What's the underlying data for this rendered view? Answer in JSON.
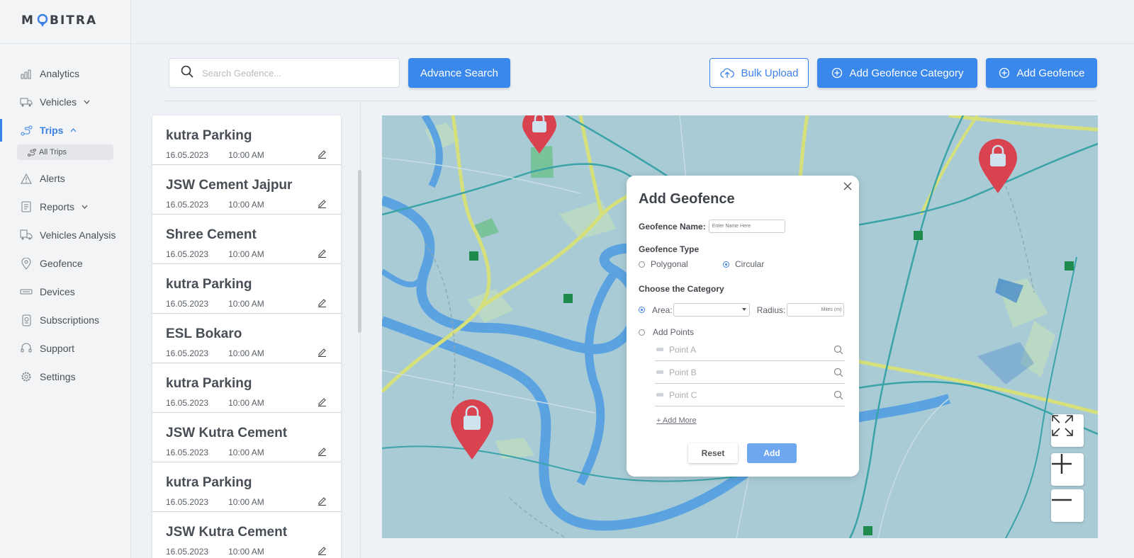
{
  "brand": {
    "logo_text": "MOBITRA"
  },
  "sidebar": {
    "items": [
      {
        "label": "Analytics",
        "icon": "analytics-icon"
      },
      {
        "label": "Vehicles",
        "icon": "truck-icon",
        "chevron": "⌄"
      },
      {
        "label": "Trips",
        "icon": "route-icon",
        "chevron": "^",
        "active": true
      },
      {
        "label": "Alerts",
        "icon": "alert-icon"
      },
      {
        "label": "Reports",
        "icon": "report-icon",
        "chevron": "⌄"
      },
      {
        "label": "Vehicles Analysis",
        "icon": "vehicle-analysis-icon"
      },
      {
        "label": "Geofence",
        "icon": "location-pin-icon"
      },
      {
        "label": "Devices",
        "icon": "device-icon"
      },
      {
        "label": "Subscriptions",
        "icon": "subscription-icon"
      },
      {
        "label": "Support",
        "icon": "headset-icon"
      },
      {
        "label": "Settings",
        "icon": "gear-icon"
      }
    ],
    "sub_item": {
      "label": "All Trips"
    }
  },
  "toolbar": {
    "search_placeholder": "Search Geofence...",
    "advance_search": "Advance Search",
    "bulk_upload": "Bulk Upload",
    "add_category": "Add Geofence Category",
    "add_geofence": "Add Geofence"
  },
  "geofence_list": [
    {
      "name": "kutra Parking",
      "date": "16.05.2023",
      "time": "10:00 AM"
    },
    {
      "name": "JSW Cement Jajpur",
      "date": "16.05.2023",
      "time": "10:00 AM"
    },
    {
      "name": "Shree Cement",
      "date": "16.05.2023",
      "time": "10:00 AM"
    },
    {
      "name": "kutra Parking",
      "date": "16.05.2023",
      "time": "10:00 AM"
    },
    {
      "name": "ESL Bokaro",
      "date": "16.05.2023",
      "time": "10:00 AM"
    },
    {
      "name": "kutra Parking",
      "date": "16.05.2023",
      "time": "10:00 AM"
    },
    {
      "name": "JSW Kutra Cement",
      "date": "16.05.2023",
      "time": "10:00 AM"
    },
    {
      "name": "kutra Parking",
      "date": "16.05.2023",
      "time": "10:00 AM"
    },
    {
      "name": "JSW Kutra Cement",
      "date": "16.05.2023",
      "time": "10:00 AM"
    }
  ],
  "modal": {
    "title": "Add Geofence",
    "name_label": "Geofence Name:",
    "name_placeholder": "Enter Name Here",
    "type_label": "Geofence Type",
    "type_options": [
      "Polygonal",
      "Circular"
    ],
    "type_selected": "Circular",
    "category_label": "Choose the Category",
    "area_label": "Area:",
    "area_value": "",
    "radius_label": "Radius:",
    "radius_placeholder": "Miles (m)",
    "add_points_label": "Add Points",
    "points": [
      "Point A",
      "Point B",
      "Point C"
    ],
    "add_more": "+ Add More",
    "reset": "Reset",
    "add": "Add"
  },
  "colors": {
    "accent": "#3b88ec",
    "map_water": "#5aa3e0",
    "map_land": "#a9cbd6",
    "marker": "#d9434f"
  }
}
